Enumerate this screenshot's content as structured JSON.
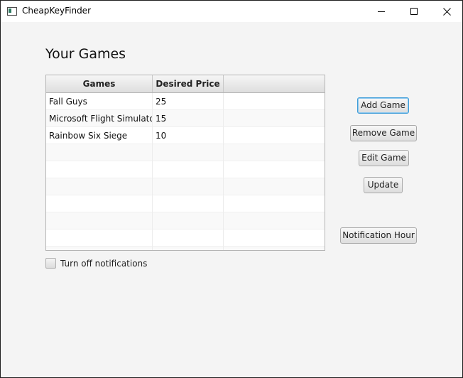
{
  "window": {
    "title": "CheapKeyFinder",
    "minimize_icon": "minimize-icon",
    "maximize_icon": "maximize-icon",
    "close_icon": "close-icon"
  },
  "heading": "Your Games",
  "table": {
    "columns": [
      "Games",
      "Desired Price",
      ""
    ],
    "rows": [
      [
        "Fall Guys",
        "25",
        ""
      ],
      [
        "Microsoft Flight Simulator",
        "15",
        ""
      ],
      [
        "Rainbow Six Siege",
        "10",
        ""
      ],
      [
        "",
        "",
        ""
      ],
      [
        "",
        "",
        ""
      ],
      [
        "",
        "",
        ""
      ],
      [
        "",
        "",
        ""
      ],
      [
        "",
        "",
        ""
      ],
      [
        "",
        "",
        ""
      ],
      [
        "",
        "",
        ""
      ]
    ]
  },
  "buttons": {
    "add_game": "Add Game",
    "remove_game": "Remove Game",
    "edit_game": "Edit Game",
    "update": "Update",
    "notification_hour": "Notification Hour"
  },
  "notifications_checkbox": {
    "label": "Turn off notifications",
    "checked": false
  }
}
